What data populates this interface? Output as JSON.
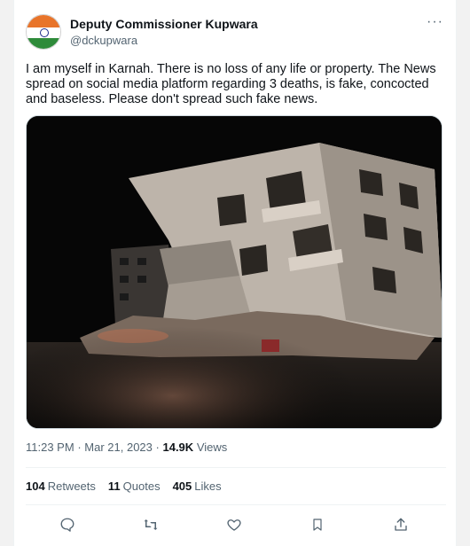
{
  "author": {
    "name": "Deputy Commissioner Kupwara",
    "handle": "@dckupwara"
  },
  "menu": {
    "more_label": "···"
  },
  "tweet": {
    "text": "I am myself in Karnah.  There is no loss of any life or property.  The News spread on social media platform regarding 3 deaths, is fake, concocted and baseless.  Please don't spread such fake news."
  },
  "meta": {
    "time": "11:23 PM",
    "separator": "·",
    "date": "Mar 21, 2023",
    "views_count": "14.9K",
    "views_label": "Views"
  },
  "stats": {
    "retweets_count": "104",
    "retweets_label": "Retweets",
    "quotes_count": "11",
    "quotes_label": "Quotes",
    "likes_count": "405",
    "likes_label": "Likes"
  },
  "icons": [
    "reply-icon",
    "retweet-icon",
    "like-icon",
    "bookmark-icon",
    "share-icon"
  ],
  "colors": {
    "muted": "#536471",
    "text": "#0f1419",
    "border": "#cfd9de"
  }
}
